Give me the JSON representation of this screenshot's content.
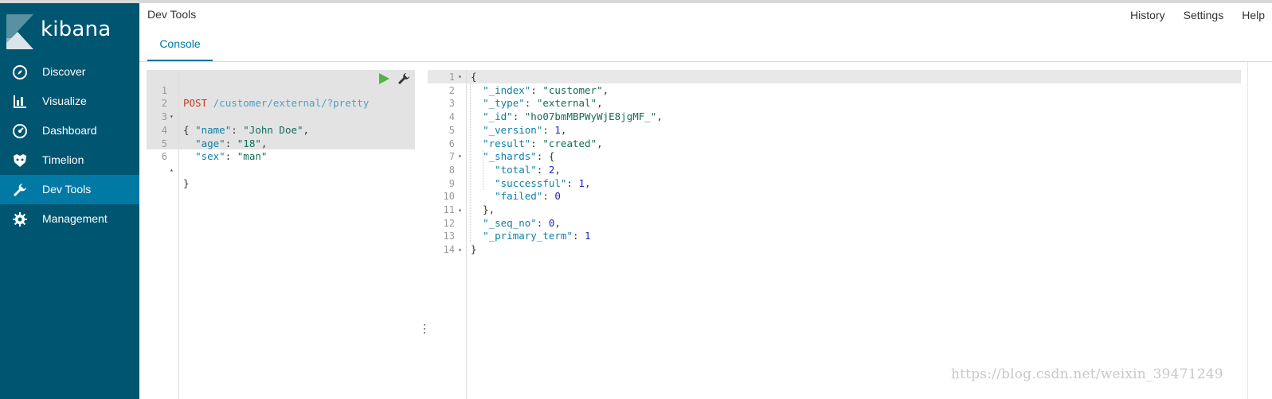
{
  "app": {
    "brand": "kibana",
    "page_title": "Dev Tools"
  },
  "header": {
    "links": [
      "History",
      "Settings",
      "Help"
    ]
  },
  "tabs": [
    {
      "label": "Console",
      "active": true
    }
  ],
  "sidebar": {
    "items": [
      {
        "label": "Discover",
        "icon": "compass-icon",
        "active": false
      },
      {
        "label": "Visualize",
        "icon": "bar-chart-icon",
        "active": false
      },
      {
        "label": "Dashboard",
        "icon": "dashboard-icon",
        "active": false
      },
      {
        "label": "Timelion",
        "icon": "timelion-icon",
        "active": false
      },
      {
        "label": "Dev Tools",
        "icon": "wrench-icon",
        "active": true
      },
      {
        "label": "Management",
        "icon": "gear-icon",
        "active": false
      }
    ]
  },
  "request": {
    "method": "POST",
    "path": "/customer/external/?pretty",
    "lines": [
      {
        "num": "1",
        "fold": ""
      },
      {
        "num": "2",
        "fold": "▾",
        "text": "{"
      },
      {
        "num": "3",
        "fold": "",
        "key": "\"name\"",
        "value": "\"John Doe\"",
        "tail": ","
      },
      {
        "num": "4",
        "fold": "",
        "key": "\"age\"",
        "value": "\"18\"",
        "tail": ","
      },
      {
        "num": "5",
        "fold": "",
        "key": "\"sex\"",
        "value": "\"man\"",
        "tail": ""
      },
      {
        "num": "6",
        "fold": "▴",
        "text": "}"
      }
    ]
  },
  "response": {
    "lines": [
      {
        "num": "1",
        "fold": "▾",
        "text": "{"
      },
      {
        "num": "2",
        "fold": "",
        "key": "\"_index\"",
        "value": "\"customer\"",
        "vtype": "s",
        "tail": ","
      },
      {
        "num": "3",
        "fold": "",
        "key": "\"_type\"",
        "value": "\"external\"",
        "vtype": "s",
        "tail": ","
      },
      {
        "num": "4",
        "fold": "",
        "key": "\"_id\"",
        "value": "\"ho07bmMBPWyWjE8jgMF_\"",
        "vtype": "s",
        "tail": ","
      },
      {
        "num": "5",
        "fold": "",
        "key": "\"_version\"",
        "value": "1",
        "vtype": "n",
        "tail": ","
      },
      {
        "num": "6",
        "fold": "",
        "key": "\"result\"",
        "value": "\"created\"",
        "vtype": "s",
        "tail": ","
      },
      {
        "num": "7",
        "fold": "▾",
        "key": "\"_shards\"",
        "value": "{",
        "vtype": "p",
        "tail": ""
      },
      {
        "num": "8",
        "fold": "",
        "key": "\"total\"",
        "value": "2",
        "vtype": "n",
        "tail": ",",
        "indent": 2
      },
      {
        "num": "9",
        "fold": "",
        "key": "\"successful\"",
        "value": "1",
        "vtype": "n",
        "tail": ",",
        "indent": 2
      },
      {
        "num": "10",
        "fold": "",
        "key": "\"failed\"",
        "value": "0",
        "vtype": "n",
        "tail": "",
        "indent": 2
      },
      {
        "num": "11",
        "fold": "▴",
        "text": "  },"
      },
      {
        "num": "12",
        "fold": "",
        "key": "\"_seq_no\"",
        "value": "0",
        "vtype": "n",
        "tail": ","
      },
      {
        "num": "13",
        "fold": "",
        "key": "\"_primary_term\"",
        "value": "1",
        "vtype": "n",
        "tail": ""
      },
      {
        "num": "14",
        "fold": "▴",
        "text": "}"
      }
    ]
  },
  "watermark": "https://blog.csdn.net/weixin_39471249",
  "colors": {
    "sidebar": "#005571",
    "active": "#0079a5",
    "method": "#c23b22"
  }
}
